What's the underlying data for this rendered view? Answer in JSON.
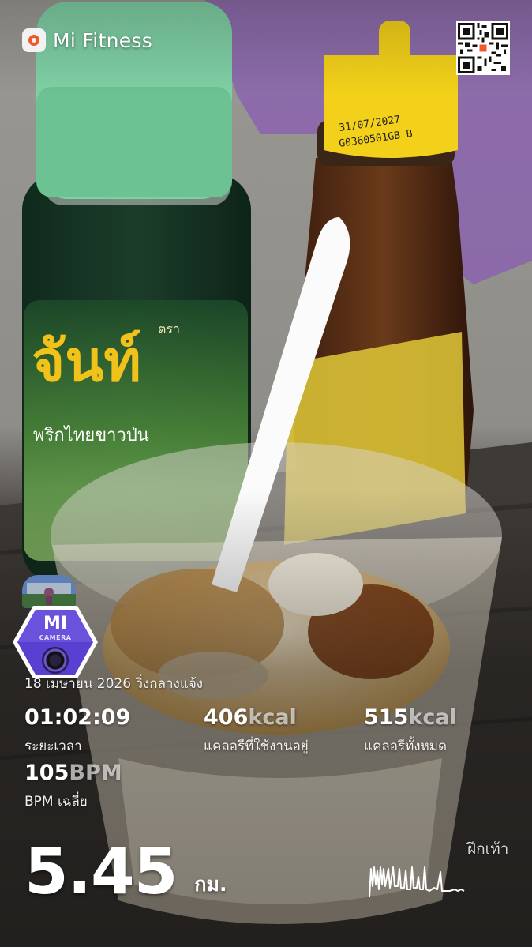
{
  "header": {
    "app_name": "Mi Fitness",
    "app_icon": "mi-fitness-icon",
    "qr_icon": "qr-code-icon"
  },
  "badge": {
    "brand": "MI",
    "subtitle": "CAMERA"
  },
  "workout": {
    "date_type": "18 เมษายน 2026 วิ่งกลางแจ้ง",
    "duration": {
      "value": "01:02:09",
      "label": "ระยะเวลา"
    },
    "active_calories": {
      "value": "406",
      "unit": "kcal",
      "label": "แคลอรีที่ใช้งานอยู่"
    },
    "total_calories": {
      "value": "515",
      "unit": "kcal",
      "label": "แคลอรีทั้งหมด"
    },
    "avg_bpm": {
      "value": "105",
      "unit": "BPM",
      "label": "BPM เฉลี่ย"
    },
    "distance": {
      "value": "5.45",
      "unit": "กม."
    },
    "activity_label": "ฝึกเท้า"
  },
  "photo": {
    "left_bottle_brand": "จันท์",
    "left_bottle_small": "ตรา",
    "left_bottle_sub": "พริกไทยขาวป่น",
    "right_bottle_code_1": "31/07/2027",
    "right_bottle_code_2": "G0360501GB B"
  },
  "colors": {
    "accent": "#f05a28",
    "badge_purple": "#5a3fd0"
  }
}
